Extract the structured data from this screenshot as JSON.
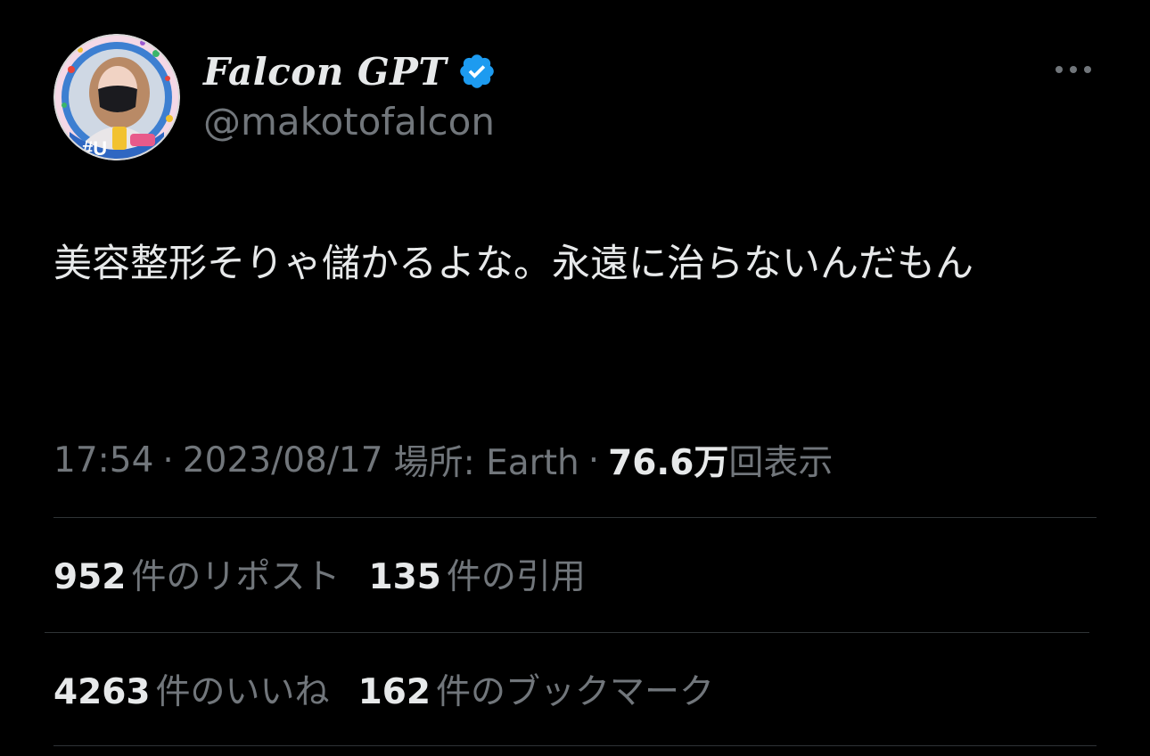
{
  "author": {
    "display_name": "Falcon GPT",
    "handle": "@makotofalcon",
    "avatar_badge_text": "#U",
    "verified": true
  },
  "tweet": {
    "text": "美容整形そりゃ儲かるよな。永遠に治らないんだもん"
  },
  "meta": {
    "time": "17:54",
    "date": "2023/08/17",
    "location": "場所: Earth",
    "views_count": "76.6万",
    "views_label": "回表示",
    "separator": "·"
  },
  "stats": {
    "reposts": {
      "count": "952",
      "label": "件のリポスト"
    },
    "quotes": {
      "count": "135",
      "label": "件の引用"
    },
    "likes": {
      "count": "4263",
      "label": "件のいいね"
    },
    "bookmarks": {
      "count": "162",
      "label": "件のブックマーク"
    }
  },
  "colors": {
    "background": "#000000",
    "primary_text": "#e7e9ea",
    "secondary_text": "#71767b",
    "verified_badge": "#1d9bf0",
    "divider": "#2f3336"
  },
  "icons": {
    "verified": "verified-badge-icon",
    "more": "more-options-icon"
  }
}
